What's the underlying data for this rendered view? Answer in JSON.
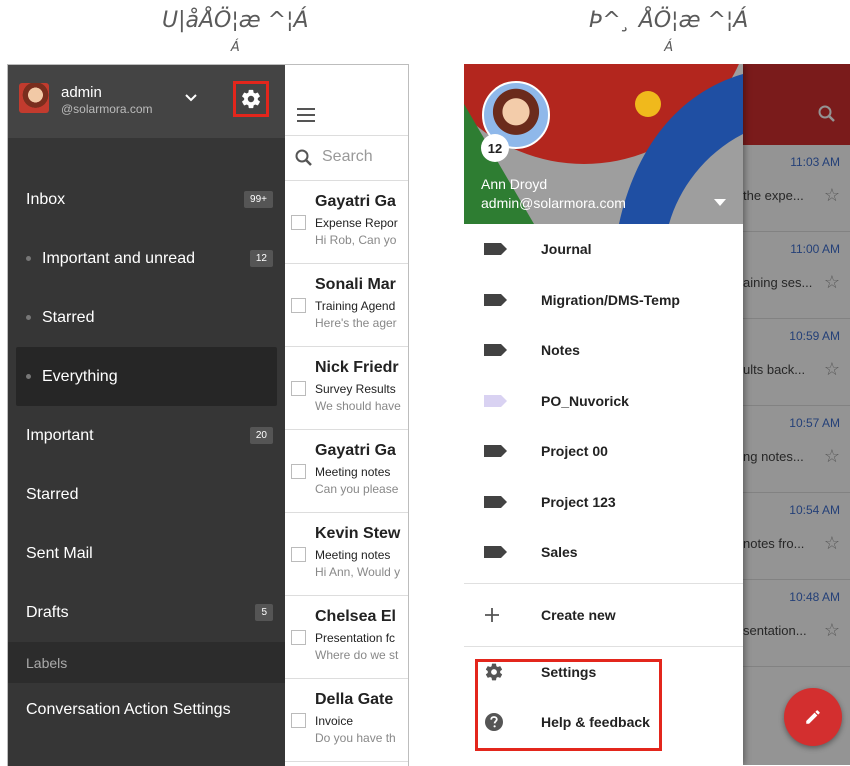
{
  "captions": {
    "left": {
      "title": "Ս|åÅÖ¦æ ^¦Á",
      "sub": "Á"
    },
    "right": {
      "title": "Þ^¸ ÅÖ¦æ ^¦Á",
      "sub": "Á"
    }
  },
  "left_app": {
    "account": {
      "name": "admin",
      "email": "@solarmora.com"
    },
    "icons": {
      "settings": "gear-icon",
      "menu": "hamburger-icon",
      "search": "search-icon",
      "expand": "chevron-down-icon"
    },
    "nav": [
      {
        "label": "Inbox",
        "badge": "99+"
      },
      {
        "label": "Important and unread",
        "badge": "12"
      },
      {
        "label": "Starred",
        "badge": ""
      },
      {
        "label": "Everything",
        "badge": ""
      },
      {
        "label": "Important",
        "badge": "20"
      },
      {
        "label": "Starred",
        "badge": ""
      },
      {
        "label": "Sent Mail",
        "badge": ""
      },
      {
        "label": "Drafts",
        "badge": "5"
      }
    ],
    "labels_header": "Labels",
    "settings_item": "Conversation Action Settings",
    "search_placeholder": "Search",
    "mails": [
      {
        "sender": "Gayatri Ga",
        "subject": "Expense Repor",
        "snippet": "Hi Rob, Can yo"
      },
      {
        "sender": "Sonali Mar",
        "subject": "Training Agend",
        "snippet": "Here's the ager"
      },
      {
        "sender": "Nick Friedr",
        "subject": "Survey Results",
        "snippet": "We should have"
      },
      {
        "sender": "Gayatri Ga",
        "subject": "Meeting notes",
        "snippet": "Can you please"
      },
      {
        "sender": "Kevin Stew",
        "subject": "Meeting notes",
        "snippet": "Hi Ann, Would y"
      },
      {
        "sender": "Chelsea El",
        "subject": "Presentation fc",
        "snippet": "Where do we st"
      },
      {
        "sender": "Della Gate",
        "subject": "Invoice",
        "snippet": "Do you have th"
      }
    ]
  },
  "right_app": {
    "user": {
      "name": "Ann Droyd",
      "email": "admin@solarmora.com",
      "unread": "12"
    },
    "labels": [
      {
        "label": "Journal",
        "color": "#424242"
      },
      {
        "label": "Migration/DMS-Temp",
        "color": "#424242"
      },
      {
        "label": "Notes",
        "color": "#424242"
      },
      {
        "label": "PO_Nuvorick",
        "color": "#d9d2f2"
      },
      {
        "label": "Project 00",
        "color": "#424242"
      },
      {
        "label": "Project 123",
        "color": "#424242"
      },
      {
        "label": "Sales",
        "color": "#424242"
      }
    ],
    "create_new": "Create new",
    "settings": "Settings",
    "help": "Help & feedback",
    "background_rows": [
      {
        "time": "11:03 AM",
        "snippet": "the expe..."
      },
      {
        "time": "11:00 AM",
        "snippet": "aining ses..."
      },
      {
        "time": "10:59 AM",
        "snippet": "ults back..."
      },
      {
        "time": "10:57 AM",
        "snippet": "ng notes..."
      },
      {
        "time": "10:54 AM",
        "snippet": "notes fro..."
      },
      {
        "time": "10:48 AM",
        "snippet": "sentation..."
      }
    ],
    "icons": {
      "search": "search-icon",
      "compose": "pencil-icon",
      "star": "☆"
    },
    "colors": {
      "toolbar": "#d32f2f",
      "highlight": "#e3261c",
      "link_time": "#3f6fcf"
    }
  }
}
